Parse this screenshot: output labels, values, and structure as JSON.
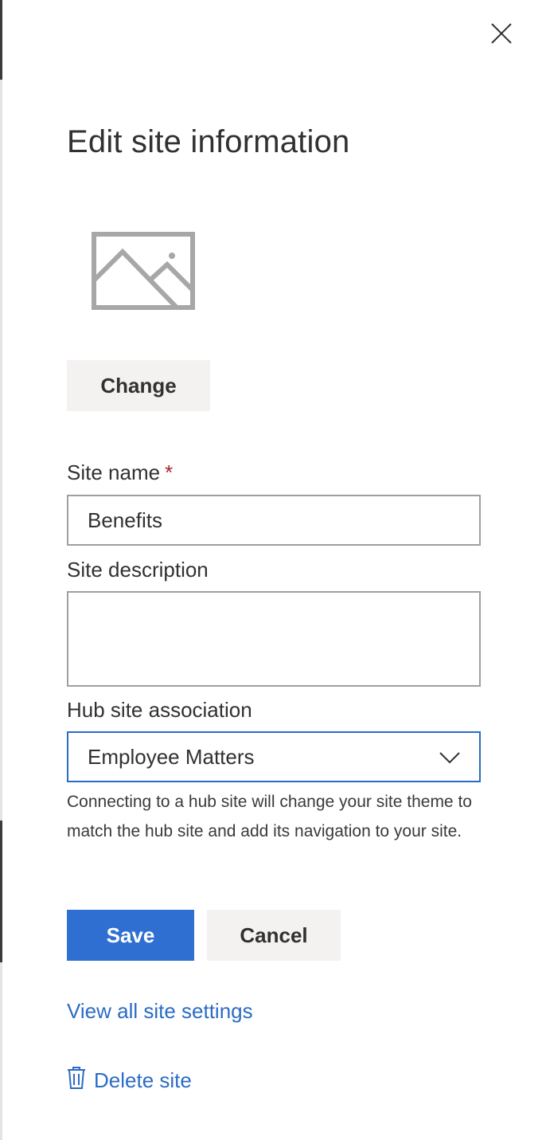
{
  "panel": {
    "title": "Edit site information",
    "close_icon": "close-icon",
    "logo_icon": "image-placeholder-icon",
    "change_label": "Change"
  },
  "form": {
    "site_name": {
      "label": "Site name",
      "required_marker": "*",
      "value": "Benefits"
    },
    "site_description": {
      "label": "Site description",
      "value": ""
    },
    "hub_association": {
      "label": "Hub site association",
      "selected": "Employee Matters",
      "chevron_icon": "chevron-down-icon",
      "help_text": "Connecting to a hub site will change your site theme to match the hub site and add its navigation to your site."
    }
  },
  "actions": {
    "save_label": "Save",
    "cancel_label": "Cancel"
  },
  "links": {
    "view_all_settings": "View all site settings",
    "delete_site": "Delete site",
    "delete_icon": "trash-icon"
  },
  "colors": {
    "accent": "#2f6fd1",
    "link": "#2b6cc4",
    "required": "#a4262c",
    "neutral_button": "#f3f2f1"
  }
}
